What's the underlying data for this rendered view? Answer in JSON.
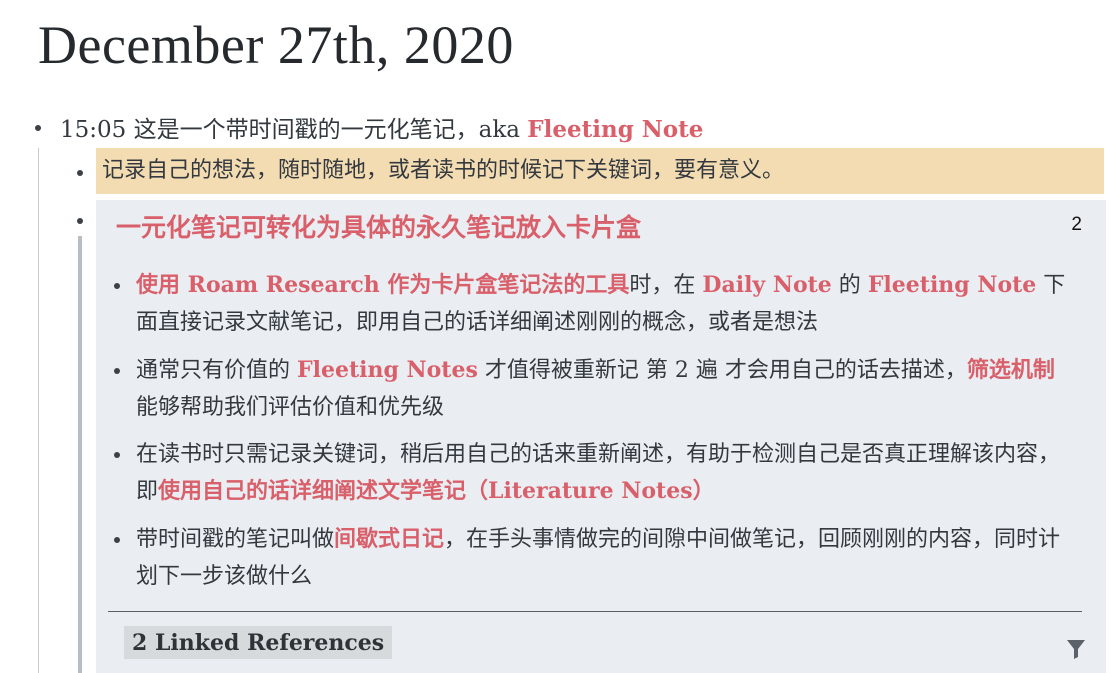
{
  "page": {
    "title": "December 27th, 2020"
  },
  "block1": {
    "timestamp": "15:05",
    "text": " 这是一个带时间戳的一元化笔记，aka ",
    "link": "Fleeting Note"
  },
  "block2": {
    "text": "记录自己的想法，随时随地，或者读书的时候记下关键词，要有意义。"
  },
  "card": {
    "title": "一元化笔记可转化为具体的永久笔记放入卡片盒",
    "count": "2",
    "items": [
      {
        "link1": "使用 Roam Research 作为卡片盒笔记法的工具",
        "t1": "时，在 ",
        "link2": "Daily Note",
        "t2": " 的 ",
        "link3": "Fleeting Note",
        "t3": " 下面直接记录文献笔记，即用自己的话详细阐述刚刚的概念，或者是想法"
      },
      {
        "t1": "通常只有价值的 ",
        "link1": "Fleeting Notes",
        "t2": " 才值得被重新记 第 2 遍 才会用自己的话去描述，",
        "link2": "筛选机制",
        "t3": "能够帮助我们评估价值和优先级"
      },
      {
        "t1": "在读书时只需记录关键词，稍后用自己的话来重新阐述，有助于检测自己是否真正理解该内容，即",
        "link1": "使用自己的话详细阐述文学笔记（Literature Notes）"
      },
      {
        "t1": "带时间戳的笔记叫做",
        "link1": "间歇式日记",
        "t2": "，在手头事情做完的间隙中间做笔记，回顾刚刚的内容，同时计划下一步该做什么"
      }
    ],
    "linked_references": "2 Linked References",
    "filter_icon": "filter-icon"
  },
  "colors": {
    "link": "#d9606b",
    "highlight": "#f3dcb2",
    "card_bg": "#eaeef2"
  }
}
